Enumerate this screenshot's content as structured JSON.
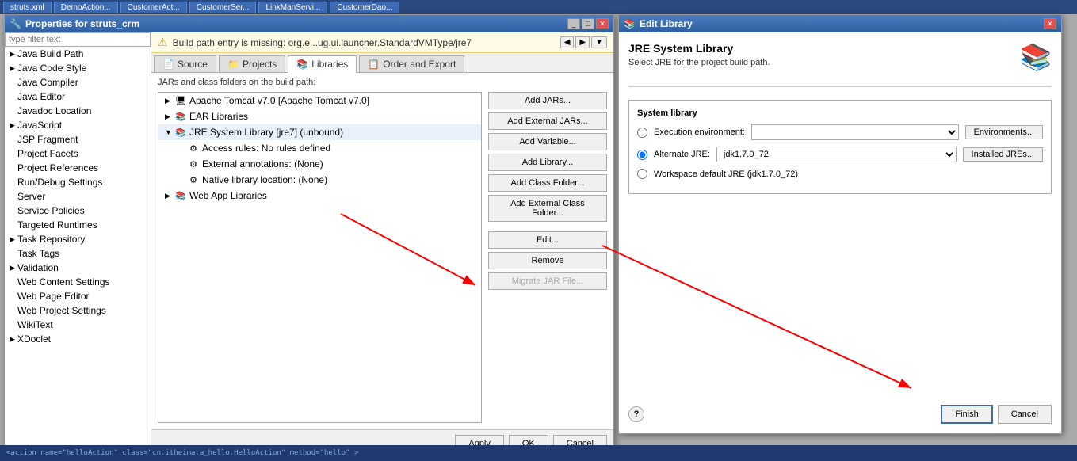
{
  "taskbar": {
    "tabs": [
      "struts.xml",
      "DemoAction...",
      "CustomerAct...",
      "CustomerSer...",
      "LinkManServi...",
      "CustomerDao..."
    ]
  },
  "props_window": {
    "title": "Properties for struts_crm",
    "filter_placeholder": "type filter text",
    "sidebar_items": [
      {
        "label": "Java Build Path",
        "indent": 0,
        "arrow": "▶",
        "selected": true
      },
      {
        "label": "Java Code Style",
        "indent": 0,
        "arrow": "▶"
      },
      {
        "label": "Java Compiler",
        "indent": 0,
        "arrow": ""
      },
      {
        "label": "Java Editor",
        "indent": 0,
        "arrow": ""
      },
      {
        "label": "Javadoc Location",
        "indent": 0,
        "arrow": ""
      },
      {
        "label": "JavaScript",
        "indent": 0,
        "arrow": "▶"
      },
      {
        "label": "JSP Fragment",
        "indent": 0,
        "arrow": ""
      },
      {
        "label": "Project Facets",
        "indent": 0,
        "arrow": ""
      },
      {
        "label": "Project References",
        "indent": 0,
        "arrow": ""
      },
      {
        "label": "Run/Debug Settings",
        "indent": 0,
        "arrow": ""
      },
      {
        "label": "Server",
        "indent": 0,
        "arrow": ""
      },
      {
        "label": "Service Policies",
        "indent": 0,
        "arrow": ""
      },
      {
        "label": "Targeted Runtimes",
        "indent": 0,
        "arrow": ""
      },
      {
        "label": "Task Repository",
        "indent": 0,
        "arrow": "▶"
      },
      {
        "label": "Task Tags",
        "indent": 0,
        "arrow": ""
      },
      {
        "label": "Validation",
        "indent": 0,
        "arrow": "▶"
      },
      {
        "label": "Web Content Settings",
        "indent": 0,
        "arrow": ""
      },
      {
        "label": "Web Page Editor",
        "indent": 0,
        "arrow": ""
      },
      {
        "label": "Web Project Settings",
        "indent": 0,
        "arrow": ""
      },
      {
        "label": "WikiText",
        "indent": 0,
        "arrow": ""
      },
      {
        "label": "XDoclet",
        "indent": 0,
        "arrow": "▶"
      }
    ],
    "warning_text": "Build path entry is missing: org.e...ug.ui.launcher.StandardVMType/jre7",
    "tabs": [
      {
        "label": "Source",
        "icon": "📄"
      },
      {
        "label": "Projects",
        "icon": "📁"
      },
      {
        "label": "Libraries",
        "icon": "📚",
        "active": true
      },
      {
        "label": "Order and Export",
        "icon": "📋"
      }
    ],
    "build_path_label": "JARs and class folders on the build path:",
    "tree_items": [
      {
        "indent": 0,
        "arrow": "▶",
        "label": "Apache Tomcat v7.0 [Apache Tomcat v7.0]",
        "icon": "🖥"
      },
      {
        "indent": 0,
        "arrow": "▶",
        "label": "EAR Libraries",
        "icon": "📚"
      },
      {
        "indent": 0,
        "arrow": "▼",
        "label": "JRE System Library [jre7] (unbound)",
        "icon": "📚",
        "expanded": true
      },
      {
        "indent": 1,
        "arrow": "",
        "label": "Access rules: No rules defined",
        "icon": "⚙"
      },
      {
        "indent": 1,
        "arrow": "",
        "label": "External annotations: (None)",
        "icon": "⚙"
      },
      {
        "indent": 1,
        "arrow": "",
        "label": "Native library location: (None)",
        "icon": "⚙"
      },
      {
        "indent": 0,
        "arrow": "▶",
        "label": "Web App Libraries",
        "icon": "📚"
      }
    ],
    "buttons": [
      {
        "label": "Add JARs...",
        "disabled": false
      },
      {
        "label": "Add External JARs...",
        "disabled": false
      },
      {
        "label": "Add Variable...",
        "disabled": false
      },
      {
        "label": "Add Library...",
        "disabled": false
      },
      {
        "label": "Add Class Folder...",
        "disabled": false
      },
      {
        "label": "Add External Class Folder...",
        "disabled": false
      },
      {
        "label": "Edit...",
        "disabled": false
      },
      {
        "label": "Remove",
        "disabled": false
      },
      {
        "label": "Migrate JAR File...",
        "disabled": true
      }
    ],
    "bottom_buttons": [
      {
        "label": "Apply"
      },
      {
        "label": "OK"
      },
      {
        "label": "Cancel"
      }
    ]
  },
  "edit_lib_dialog": {
    "title": "Edit Library",
    "heading": "JRE System Library",
    "subtitle": "Select JRE for the project build path.",
    "group_label": "System library",
    "execution_env_label": "Execution environment:",
    "alternate_jre_label": "Alternate JRE:",
    "workspace_jre_label": "Workspace default JRE (jdk1.7.0_72)",
    "alternate_jre_value": "jdk1.7.0_72",
    "environments_btn": "Environments...",
    "installed_jres_btn": "Installed JREs...",
    "finish_btn": "Finish",
    "cancel_btn": "Cancel",
    "help_label": "?"
  },
  "bottom_strip": {
    "code": "<action name=\"helloAction\" class=\"cn.itheima.a_hello.HelloAction\" method=\"hello\" >"
  }
}
